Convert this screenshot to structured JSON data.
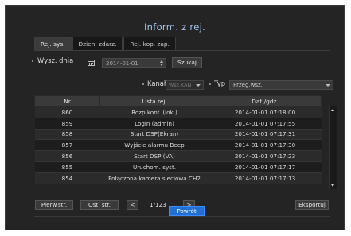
{
  "dialog": {
    "title": "Inform. z rej."
  },
  "tabs": [
    {
      "label": "Rej. sys.",
      "active": true
    },
    {
      "label": "Dzien. zdarz.",
      "active": false
    },
    {
      "label": "Rej. kop. zap.",
      "active": false
    }
  ],
  "search": {
    "label": "Wysz. dnia",
    "date_value": "2014-01-01",
    "search_button": "Szukaj",
    "channel_label": "Kanał",
    "channel_value": "Wsz.KAN",
    "type_label": "Typ",
    "type_value": "Przeg.wsz."
  },
  "table": {
    "headers": [
      "Nr",
      "Lista rej.",
      "Dat./gdz."
    ],
    "rows": [
      [
        "860",
        "Rozp.konf. (lok.)",
        "2014-01-01 07:18:00"
      ],
      [
        "859",
        "Login (admin)",
        "2014-01-01 07:17:55"
      ],
      [
        "858",
        "Start DSP(Ekran)",
        "2014-01-01 07:17:31"
      ],
      [
        "857",
        "Wyjście alarmu Beep",
        "2014-01-01 07:17:30"
      ],
      [
        "856",
        "Start DSP (VA)",
        "2014-01-01 07:17:23"
      ],
      [
        "855",
        "Uruchom. syst.",
        "2014-01-01 07:17:17"
      ],
      [
        "854",
        "Połączona kamera sieciowa CH2",
        "2014-01-01 07:17:13"
      ]
    ]
  },
  "pager": {
    "first": "Pierw.str.",
    "last": "Ost. str.",
    "prev": "<",
    "next": ">",
    "page": "1/123",
    "export": "Eksportuj"
  },
  "footer": {
    "back": "Powrót"
  },
  "colors": {
    "accent": "#1f6fd6",
    "title": "#9ec3f0",
    "background": "#242424"
  }
}
